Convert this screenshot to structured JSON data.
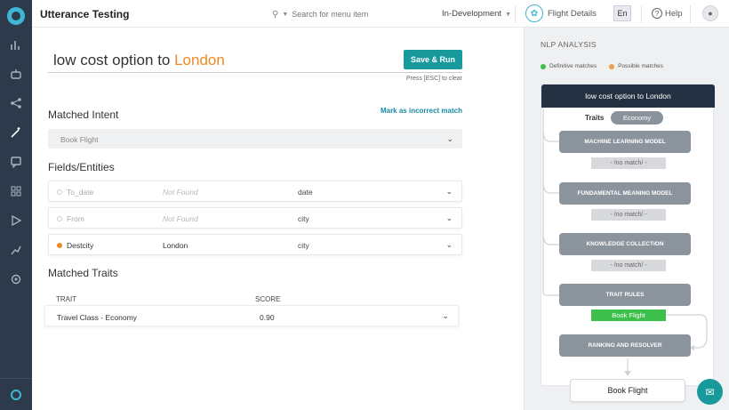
{
  "app": {
    "title": "Utterance Testing"
  },
  "header": {
    "search_placeholder": "Search for menu item",
    "environment": "In-Development",
    "bot_name": "Flight Details",
    "language": "En",
    "help": "Help"
  },
  "utterance": {
    "text_part1": "low cost option ",
    "text_part2": "to ",
    "highlight": "London",
    "save_run": "Save & Run",
    "esc_hint": "Press [ESC] to clear"
  },
  "matched_intent": {
    "title": "Matched Intent",
    "mark_incorrect": "Mark as incorrect match",
    "value": "Book Flight"
  },
  "entities": {
    "title": "Fields/Entities",
    "rows": [
      {
        "name": "To_date",
        "value": "Not Found",
        "type": "date"
      },
      {
        "name": "From",
        "value": "Not Found",
        "type": "city"
      },
      {
        "name": "Destcity",
        "value": "London",
        "type": "city"
      }
    ]
  },
  "traits": {
    "title": "Matched Traits",
    "col_trait": "TRAIT",
    "col_score": "SCORE",
    "rows": [
      {
        "trait": "Travel Class - Economy",
        "score": "0.90"
      }
    ]
  },
  "nlp": {
    "title": "NLP ANALYSIS",
    "legend_definitive": "Definitive matches",
    "legend_possible": "Possible matches",
    "utterance": "low cost option to London",
    "traits_label": "Traits",
    "trait_pill": "Economy",
    "stages": [
      "MACHINE LEARNING MODEL",
      "FUNDAMENTAL MEANING MODEL",
      "KNOWLEDGE COLLECTION",
      "TRAIT RULES",
      "RANKING AND RESOLVER"
    ],
    "no_match": "- /no match/ -",
    "trait_result": "Book Flight",
    "final_result": "Book Flight"
  },
  "colors": {
    "accent": "#189a9c",
    "highlight": "#f08a24",
    "definitive": "#3dc04b",
    "possible": "#f0a04a",
    "sidebar": "#2c3a4b"
  }
}
